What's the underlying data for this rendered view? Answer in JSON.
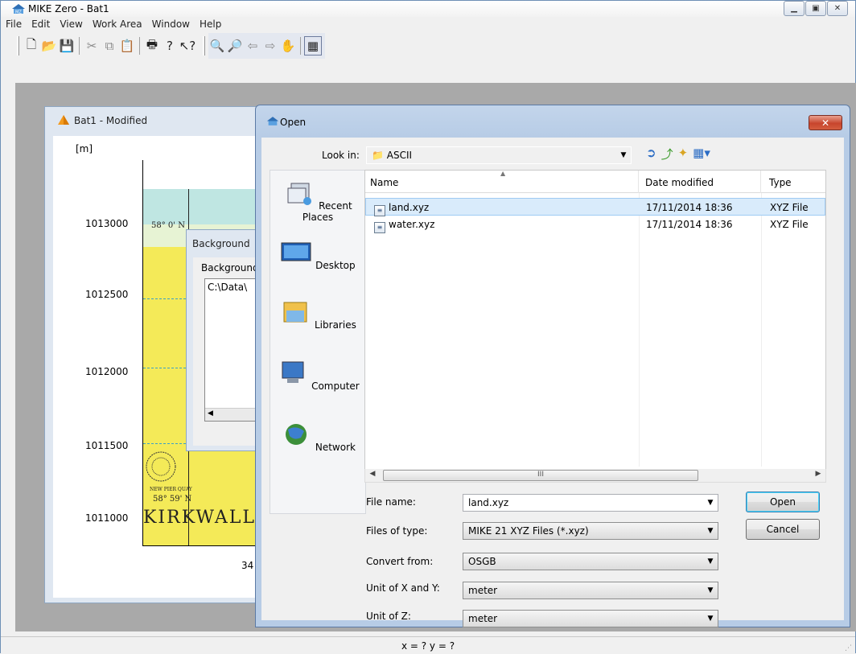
{
  "app": {
    "title": "MIKE Zero - Bat1",
    "menu": [
      "File",
      "Edit",
      "View",
      "Work Area",
      "Window",
      "Help"
    ],
    "status": "x = ?  y = ?"
  },
  "child": {
    "title": "Bat1 - Modified",
    "unit": "[m]",
    "y_ticks": [
      "1013000",
      "1012500",
      "1012000",
      "1011500",
      "1011000"
    ],
    "x_tick_partial": "34",
    "map_labels": {
      "lat1": "58° 0' N",
      "lat2": "58° 59' N",
      "town": "KIRKWALL",
      "small": "NEW PIER QUAY"
    }
  },
  "background_dialog": {
    "title": "Background",
    "label": "Background",
    "item": "C:\\Data\\"
  },
  "open_dialog": {
    "title": "Open",
    "look_in_label": "Look in:",
    "look_in_value": "ASCII",
    "places": [
      "Recent Places",
      "Desktop",
      "Libraries",
      "Computer",
      "Network"
    ],
    "columns": [
      "Name",
      "Date modified",
      "Type"
    ],
    "files": [
      {
        "name": "land.xyz",
        "date": "17/11/2014 18:36",
        "type": "XYZ File",
        "selected": true
      },
      {
        "name": "water.xyz",
        "date": "17/11/2014 18:36",
        "type": "XYZ File",
        "selected": false
      }
    ],
    "scroll_grip": "III",
    "file_name_label": "File name:",
    "file_name_value": "land.xyz",
    "files_of_type_label": "Files of type:",
    "files_of_type_value": "MIKE 21 XYZ Files (*.xyz)",
    "convert_from_label": "Convert from:",
    "convert_from_value": "OSGB",
    "unit_xy_label": "Unit of X and Y:",
    "unit_xy_value": "meter",
    "unit_z_label": "Unit of Z:",
    "unit_z_value": "meter",
    "open_button": "Open",
    "cancel_button": "Cancel"
  }
}
